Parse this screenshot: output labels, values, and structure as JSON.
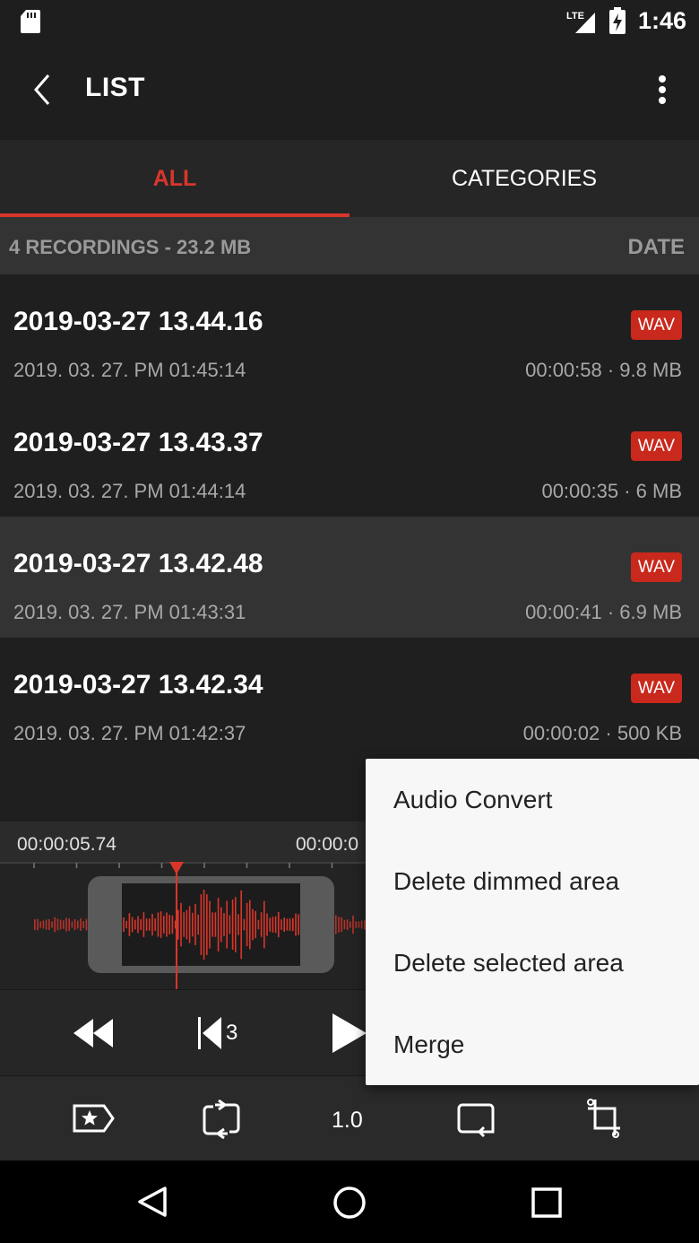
{
  "status_bar": {
    "time": "1:46",
    "network": "LTE"
  },
  "app_bar": {
    "title": "LIST"
  },
  "tabs": [
    {
      "label": "ALL",
      "active": true
    },
    {
      "label": "CATEGORIES",
      "active": false
    }
  ],
  "summary": {
    "count_text": "4 RECORDINGS - 23.2 MB",
    "sort_label": "DATE"
  },
  "recordings": [
    {
      "name": "2019-03-27 13.44.16",
      "format": "WAV",
      "date": "2019. 03. 27. PM 01:45:14",
      "meta": "00:00:58 · 9.8 MB"
    },
    {
      "name": "2019-03-27 13.43.37",
      "format": "WAV",
      "date": "2019. 03. 27. PM 01:44:14",
      "meta": "00:00:35 · 6 MB"
    },
    {
      "name": "2019-03-27 13.42.48",
      "format": "WAV",
      "date": "2019. 03. 27. PM 01:43:31",
      "meta": "00:00:41 · 6.9 MB",
      "selected": true
    },
    {
      "name": "2019-03-27 13.42.34",
      "format": "WAV",
      "date": "2019. 03. 27. PM 01:42:37",
      "meta": "00:00:02 · 500 KB"
    }
  ],
  "player": {
    "time_left": "00:00:05.74",
    "time_right": "00:00:0",
    "skip_seconds": "3",
    "speed": "1.0"
  },
  "popup_menu": {
    "items": [
      "Audio Convert",
      "Delete dimmed area",
      "Delete selected area",
      "Merge"
    ]
  },
  "colors": {
    "accent": "#d9362b",
    "badge": "#c9281c",
    "background": "#1f1f1f",
    "selected_row": "#333333",
    "menu_bg": "#f7f7f7"
  },
  "icons": [
    "sd-card-icon",
    "signal-icon",
    "battery-charging-icon",
    "back-arrow-icon",
    "more-vert-icon",
    "rewind-icon",
    "skip-back-icon",
    "play-icon",
    "tag-star-icon",
    "repeat-icon",
    "trim-icon",
    "crop-icon",
    "nav-back-icon",
    "nav-home-icon",
    "nav-recents-icon"
  ]
}
